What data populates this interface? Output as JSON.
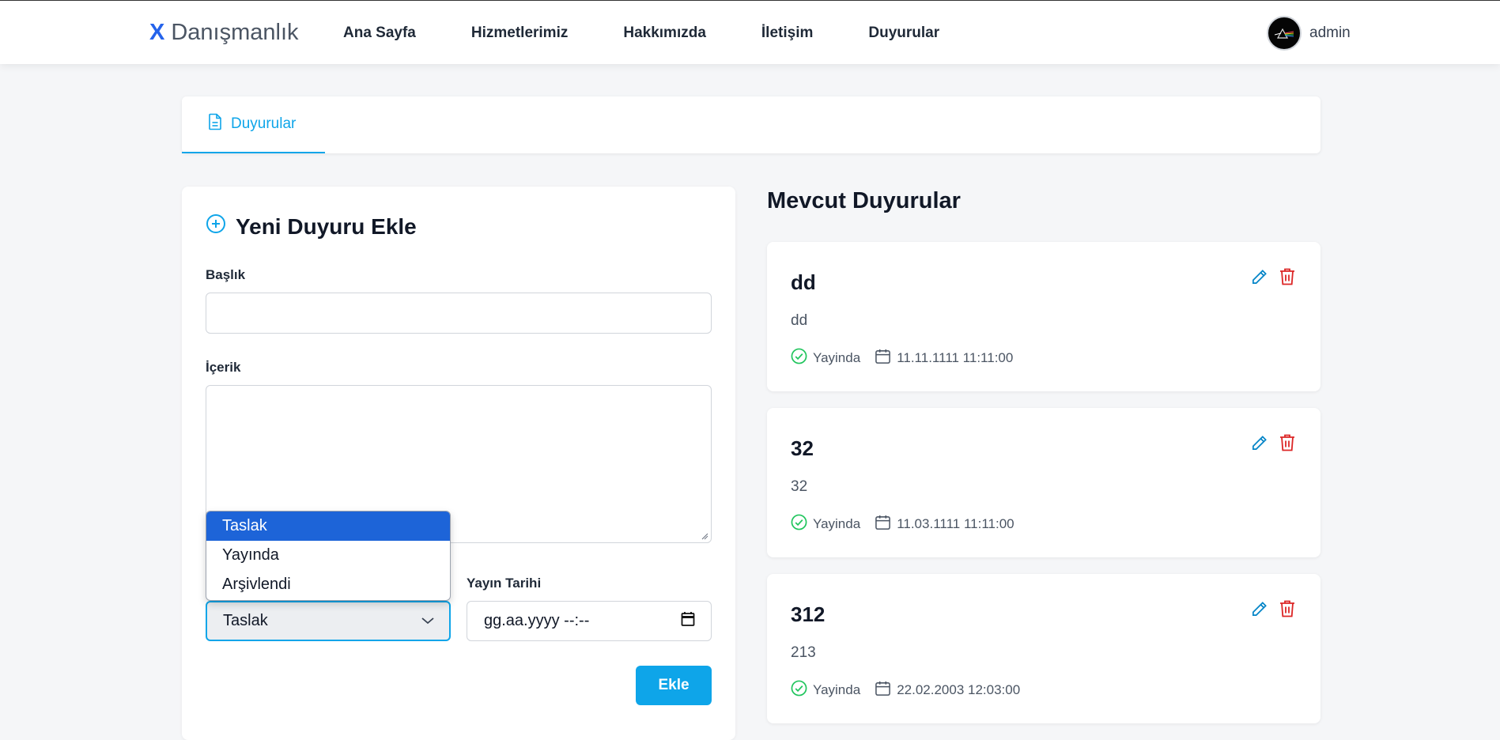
{
  "header": {
    "brand_mark": "X",
    "brand_name": "Danışmanlık",
    "nav": [
      "Ana Sayfa",
      "Hizmetlerimiz",
      "Hakkımızda",
      "İletişim",
      "Duyurular"
    ],
    "user_name": "admin"
  },
  "tabs": {
    "active_label": "Duyurular"
  },
  "form": {
    "title": "Yeni Duyuru Ekle",
    "title_label": "Başlık",
    "title_value": "",
    "content_label": "İçerik",
    "content_value": "",
    "date_label": "Yayın Tarihi",
    "date_value": "gg.aa.yyyy --:--",
    "status_selected": "Taslak",
    "status_options": [
      "Taslak",
      "Yayında",
      "Arşivlendi"
    ],
    "submit_label": "Ekle"
  },
  "list": {
    "title": "Mevcut Duyurular",
    "items": [
      {
        "title": "dd",
        "body": "dd",
        "status": "Yayinda",
        "date": "11.11.1111 11:11:00"
      },
      {
        "title": "32",
        "body": "32",
        "status": "Yayinda",
        "date": "11.03.1111 11:11:00"
      },
      {
        "title": "312",
        "body": "213",
        "status": "Yayinda",
        "date": "22.02.2003 12:03:00"
      }
    ]
  },
  "colors": {
    "accent": "#0ea5e9",
    "brand": "#2563eb",
    "success": "#22c55e",
    "danger": "#dc2626",
    "dropdown_highlight": "#1d64d8"
  },
  "icons": {
    "tab": "document-icon",
    "form_title": "plus-circle-icon",
    "status": "check-circle-icon",
    "date": "calendar-icon",
    "edit": "pencil-icon",
    "delete": "trash-icon"
  }
}
